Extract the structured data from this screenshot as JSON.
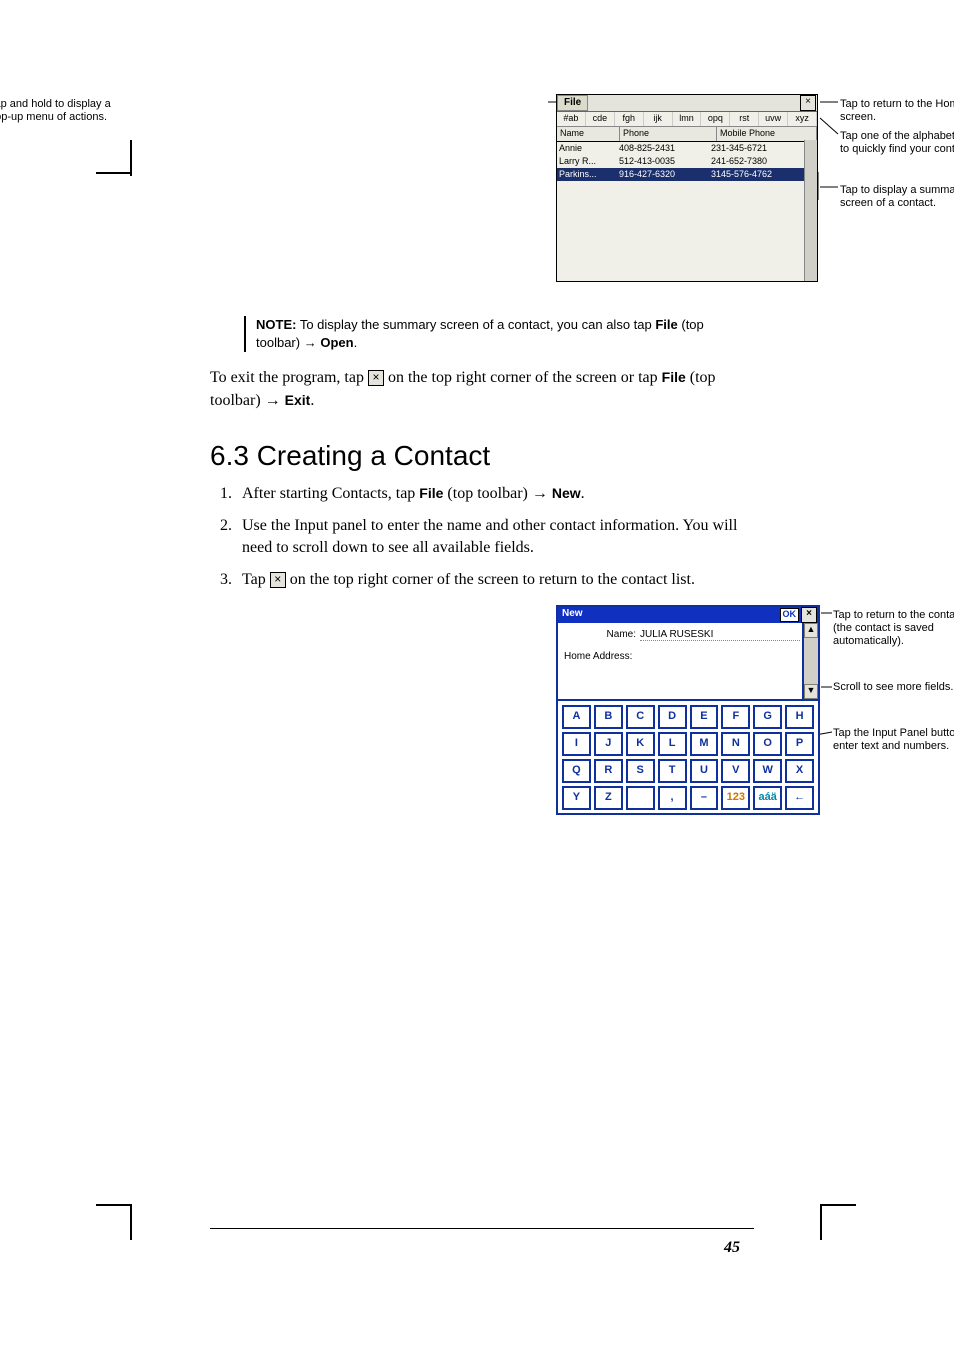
{
  "fig1": {
    "left_callout": "Tap and hold to display a pop-up menu of actions.",
    "right_callouts": [
      "Tap to return to the Home screen.",
      "Tap one of the alphabet sets to quickly find your contacts.",
      "Tap to display a summary screen of a contact."
    ],
    "menu": "File",
    "close_glyph": "×",
    "alpha_tabs": [
      "#ab",
      "cde",
      "fgh",
      "ijk",
      "lmn",
      "opq",
      "rst",
      "uvw",
      "xyz"
    ],
    "headers": {
      "name": "Name",
      "phone": "Phone",
      "mobile": "Mobile Phone"
    },
    "rows": [
      {
        "name": "Annie",
        "phone": "408-825-2431",
        "mobile": "231-345-6721",
        "selected": false
      },
      {
        "name": "Larry R...",
        "phone": "512-413-0035",
        "mobile": "241-652-7380",
        "selected": false
      },
      {
        "name": "Parkins...",
        "phone": "916-427-6320",
        "mobile": "3145-576-4762",
        "selected": true
      }
    ]
  },
  "note": {
    "label": "NOTE:",
    "text_before": " To display the summary screen of a contact, you can also tap ",
    "file": "File",
    "text_mid": " (top toolbar) ",
    "arrow": "→",
    "open": "Open",
    "period": "."
  },
  "exit_para": {
    "p1a": "To exit the program, tap ",
    "x": "×",
    "p1b": " on the top right corner of the screen or tap ",
    "file": "File",
    "p1c": " (top toolbar) ",
    "arrow": "→",
    "exit": "Exit",
    "period": "."
  },
  "section_heading": "6.3  Creating a Contact",
  "steps": [
    {
      "a": "After starting Contacts, tap ",
      "file": "File",
      "b": " (top toolbar) ",
      "arrow": "→",
      "new": "New",
      "c": "."
    },
    {
      "a": "Use the Input panel to enter the name and other contact information. You will need to scroll down to see all available fields.",
      "file": "",
      "b": "",
      "arrow": "",
      "new": "",
      "c": ""
    },
    {
      "a": "Tap ",
      "x": "×",
      "b": " on the top right corner of the screen to return to the contact list.",
      "file": "",
      "arrow": "",
      "new": "",
      "c": ""
    }
  ],
  "fig2": {
    "title": "New",
    "ok": "OK",
    "close": "×",
    "name_label": "Name:",
    "name_value": "JULIA RUSESKI",
    "addr_label": "Home Address:",
    "scroll_up": "▲",
    "scroll_down": "▼",
    "keys_row1": [
      "A",
      "B",
      "C",
      "D",
      "E",
      "F",
      "G",
      "H"
    ],
    "keys_row2": [
      "I",
      "J",
      "K",
      "L",
      "M",
      "N",
      "O",
      "P"
    ],
    "keys_row3": [
      "Q",
      "R",
      "S",
      "T",
      "U",
      "V",
      "W",
      "X"
    ],
    "keys_row4": [
      "Y",
      "Z",
      "",
      ",",
      "–",
      "123",
      "aáä",
      "←"
    ],
    "rcallouts": [
      "Tap to return to the contact list (the contact is saved automatically).",
      "Scroll to see more fields.",
      "Tap the Input Panel buttons to enter text and numbers."
    ]
  },
  "page_number": "45",
  "chart_data": null
}
